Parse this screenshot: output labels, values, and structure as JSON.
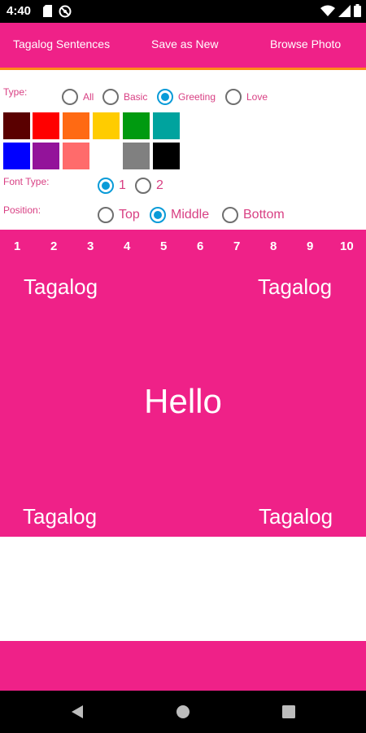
{
  "status_bar": {
    "time": "4:40"
  },
  "action_bar": {
    "tagalog_sentences": "Tagalog Sentences",
    "save_as_new": "Save as New",
    "browse_photo": "Browse Photo"
  },
  "options": {
    "type_label": "Type:",
    "type_options": [
      "All",
      "Basic",
      "Greeting",
      "Love"
    ],
    "type_selected": "Greeting",
    "colors": [
      "#5a0000",
      "#ff0000",
      "#ff6a13",
      "#ffcc00",
      "#009a10",
      "#00a39e",
      "#0000ff",
      "#93139a",
      "#ff6b6b",
      "#ffffff",
      "#808080",
      "#000000"
    ],
    "font_type_label": "Font Type:",
    "font_options": [
      "1",
      "2"
    ],
    "font_selected": "1",
    "position_label": "Position:",
    "position_options": [
      "Top",
      "Middle",
      "Bottom"
    ],
    "position_selected": "Middle"
  },
  "preview": {
    "numbers": [
      "1",
      "2",
      "3",
      "4",
      "5",
      "6",
      "7",
      "8",
      "9",
      "10"
    ],
    "top_left": "Tagalog",
    "top_right": "Tagalog",
    "center": "Hello",
    "bottom_left": "Tagalog",
    "bottom_right": "Tagalog",
    "background": "#ef2188"
  },
  "theme": {
    "accent": "#ef2188",
    "accent_underline": "#ff8a1a",
    "radio_checked": "#0a9bd8",
    "label_color": "#d83f83"
  }
}
